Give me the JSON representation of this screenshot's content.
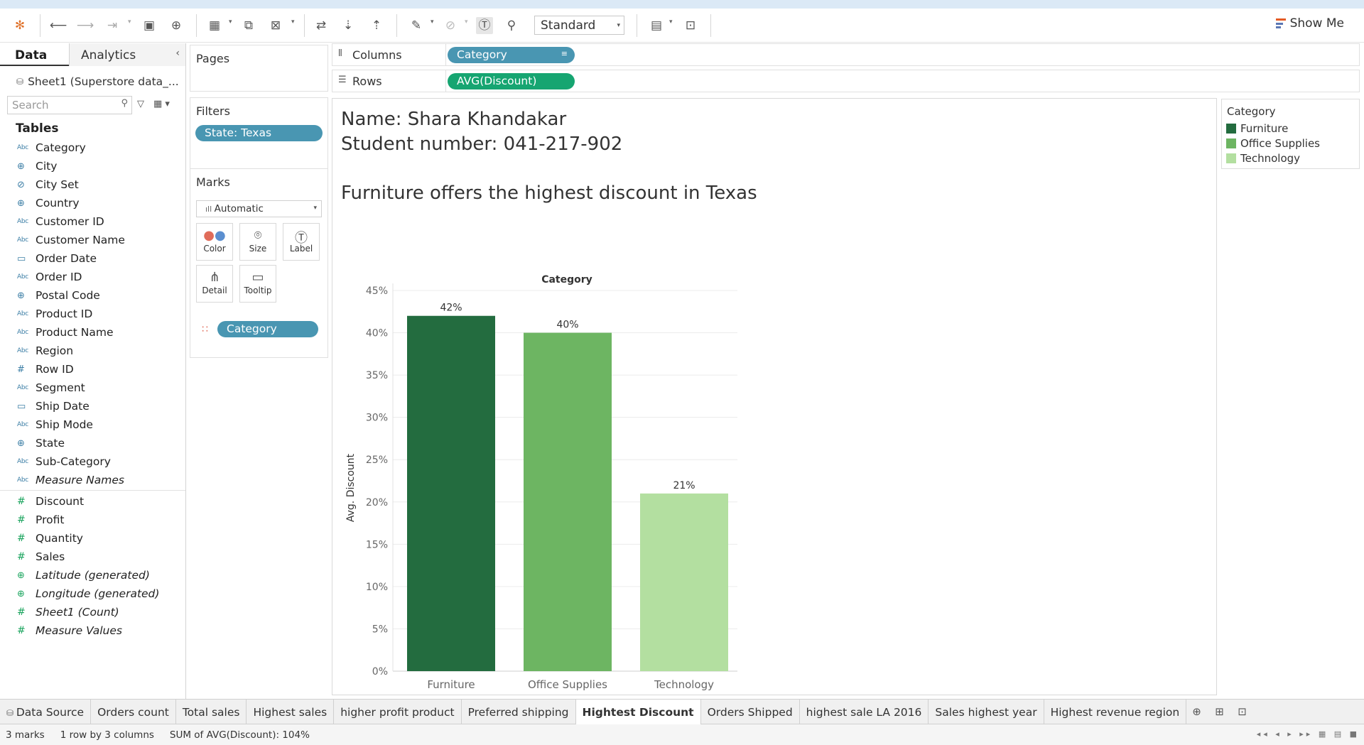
{
  "toolbar": {
    "view_size": "Standard",
    "show_me": "Show Me"
  },
  "datapane": {
    "tab_data": "Data",
    "tab_analytics": "Analytics",
    "source": "Sheet1 (Superstore data_...",
    "search_placeholder": "Search",
    "tables_heading": "Tables",
    "dimensions": [
      {
        "type": "Abc",
        "name": "Category",
        "italic": false
      },
      {
        "type": "geo",
        "name": "City",
        "italic": false
      },
      {
        "type": "set",
        "name": "City Set",
        "italic": false
      },
      {
        "type": "geo",
        "name": "Country",
        "italic": false
      },
      {
        "type": "Abc",
        "name": "Customer ID",
        "italic": false
      },
      {
        "type": "Abc",
        "name": "Customer Name",
        "italic": false
      },
      {
        "type": "date",
        "name": "Order Date",
        "italic": false
      },
      {
        "type": "Abc",
        "name": "Order ID",
        "italic": false
      },
      {
        "type": "geo",
        "name": "Postal Code",
        "italic": false
      },
      {
        "type": "Abc",
        "name": "Product ID",
        "italic": false
      },
      {
        "type": "Abc",
        "name": "Product Name",
        "italic": false
      },
      {
        "type": "Abc",
        "name": "Region",
        "italic": false
      },
      {
        "type": "num",
        "name": "Row ID",
        "italic": false
      },
      {
        "type": "Abc",
        "name": "Segment",
        "italic": false
      },
      {
        "type": "date",
        "name": "Ship Date",
        "italic": false
      },
      {
        "type": "Abc",
        "name": "Ship Mode",
        "italic": false
      },
      {
        "type": "geo",
        "name": "State",
        "italic": false
      },
      {
        "type": "Abc",
        "name": "Sub-Category",
        "italic": false
      },
      {
        "type": "Abc",
        "name": "Measure Names",
        "italic": true
      }
    ],
    "measures": [
      {
        "type": "meas",
        "name": "Discount",
        "italic": false
      },
      {
        "type": "meas",
        "name": "Profit",
        "italic": false
      },
      {
        "type": "meas",
        "name": "Quantity",
        "italic": false
      },
      {
        "type": "meas",
        "name": "Sales",
        "italic": false
      },
      {
        "type": "geo",
        "name": "Latitude (generated)",
        "italic": true
      },
      {
        "type": "geo",
        "name": "Longitude (generated)",
        "italic": true
      },
      {
        "type": "meas",
        "name": "Sheet1 (Count)",
        "italic": true
      },
      {
        "type": "meas",
        "name": "Measure Values",
        "italic": true
      }
    ]
  },
  "cards": {
    "pages_title": "Pages",
    "filters_title": "Filters",
    "filter_pill": "State: Texas",
    "marks_title": "Marks",
    "mark_type": "Automatic",
    "mark_buttons": [
      "Color",
      "Size",
      "Label",
      "Detail",
      "Tooltip"
    ],
    "color_pill": "Category"
  },
  "shelves": {
    "columns_label": "Columns",
    "columns_pill": "Category",
    "rows_label": "Rows",
    "rows_pill": "AVG(Discount)"
  },
  "view": {
    "name_line": "Name: Shara Khandakar",
    "student_line": "Student number: 041-217-902",
    "title": "Furniture  offers the highest discount in Texas"
  },
  "legend": {
    "title": "Category",
    "items": [
      "Furniture",
      "Office Supplies",
      "Technology"
    ]
  },
  "colors": {
    "furniture": "#236c3f",
    "office_supplies": "#6db562",
    "technology": "#b3dfa0",
    "dimension_pill": "#4996b2",
    "measure_pill": "#16a571"
  },
  "chart_data": {
    "type": "bar",
    "title": "",
    "header": "Category",
    "categories": [
      "Furniture",
      "Office Supplies",
      "Technology"
    ],
    "values": [
      0.42,
      0.4,
      0.21
    ],
    "value_labels": [
      "42%",
      "40%",
      "21%"
    ],
    "ylabel": "Avg. Discount",
    "ylim": [
      0,
      0.45
    ],
    "yticks": [
      "0%",
      "5%",
      "10%",
      "15%",
      "20%",
      "25%",
      "30%",
      "35%",
      "40%",
      "45%"
    ],
    "grid": true
  },
  "sheet_tabs": {
    "data_source": "Data Source",
    "tabs": [
      "Orders count",
      "Total sales",
      "Highest sales",
      "higher profit product",
      "Preferred shipping",
      "Hightest Discount",
      "Orders Shipped",
      "highest sale LA 2016",
      "Sales highest year",
      "Highest revenue region"
    ],
    "active": "Hightest Discount"
  },
  "status": {
    "marks": "3 marks",
    "dims": "1 row by 3 columns",
    "sum": "SUM of AVG(Discount): 104%"
  }
}
